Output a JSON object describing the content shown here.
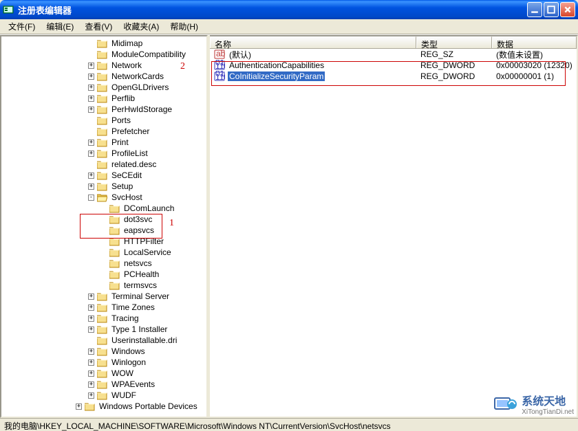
{
  "window": {
    "title": "注册表编辑器"
  },
  "menu": {
    "file": "文件(F)",
    "edit": "编辑(E)",
    "view": "查看(V)",
    "favorites": "收藏夹(A)",
    "help": "帮助(H)"
  },
  "columns": {
    "name": "名称",
    "type": "类型",
    "data": "数据"
  },
  "tree": [
    {
      "depth": 7,
      "exp": "",
      "label": "Midimap"
    },
    {
      "depth": 7,
      "exp": "",
      "label": "ModuleCompatibility"
    },
    {
      "depth": 7,
      "exp": "+",
      "label": "Network"
    },
    {
      "depth": 7,
      "exp": "+",
      "label": "NetworkCards"
    },
    {
      "depth": 7,
      "exp": "+",
      "label": "OpenGLDrivers"
    },
    {
      "depth": 7,
      "exp": "+",
      "label": "Perflib"
    },
    {
      "depth": 7,
      "exp": "+",
      "label": "PerHwIdStorage"
    },
    {
      "depth": 7,
      "exp": "",
      "label": "Ports"
    },
    {
      "depth": 7,
      "exp": "",
      "label": "Prefetcher"
    },
    {
      "depth": 7,
      "exp": "+",
      "label": "Print"
    },
    {
      "depth": 7,
      "exp": "+",
      "label": "ProfileList"
    },
    {
      "depth": 7,
      "exp": "",
      "label": "related.desc"
    },
    {
      "depth": 7,
      "exp": "+",
      "label": "SeCEdit"
    },
    {
      "depth": 7,
      "exp": "+",
      "label": "Setup"
    },
    {
      "depth": 7,
      "exp": "-",
      "label": "SvcHost"
    },
    {
      "depth": 8,
      "exp": "",
      "label": "DComLaunch"
    },
    {
      "depth": 8,
      "exp": "",
      "label": "dot3svc"
    },
    {
      "depth": 8,
      "exp": "",
      "label": "eapsvcs"
    },
    {
      "depth": 8,
      "exp": "",
      "label": "HTTPFilter"
    },
    {
      "depth": 8,
      "exp": "",
      "label": "LocalService"
    },
    {
      "depth": 8,
      "exp": "",
      "label": "netsvcs"
    },
    {
      "depth": 8,
      "exp": "",
      "label": "PCHealth"
    },
    {
      "depth": 8,
      "exp": "",
      "label": "termsvcs"
    },
    {
      "depth": 7,
      "exp": "+",
      "label": "Terminal Server"
    },
    {
      "depth": 7,
      "exp": "+",
      "label": "Time Zones"
    },
    {
      "depth": 7,
      "exp": "+",
      "label": "Tracing"
    },
    {
      "depth": 7,
      "exp": "+",
      "label": "Type 1 Installer"
    },
    {
      "depth": 7,
      "exp": "",
      "label": "Userinstallable.dri"
    },
    {
      "depth": 7,
      "exp": "+",
      "label": "Windows"
    },
    {
      "depth": 7,
      "exp": "+",
      "label": "Winlogon"
    },
    {
      "depth": 7,
      "exp": "+",
      "label": "WOW"
    },
    {
      "depth": 7,
      "exp": "+",
      "label": "WPAEvents"
    },
    {
      "depth": 7,
      "exp": "+",
      "label": "WUDF"
    },
    {
      "depth": 6,
      "exp": "+",
      "label": "Windows Portable Devices"
    }
  ],
  "values": [
    {
      "icon": "sz",
      "name": "(默认)",
      "type": "REG_SZ",
      "data": "(数值未设置)",
      "selected": false
    },
    {
      "icon": "bin",
      "name": "AuthenticationCapabilities",
      "type": "REG_DWORD",
      "data": "0x00003020 (12320)",
      "selected": false
    },
    {
      "icon": "bin",
      "name": "CoInitializeSecurityParam",
      "type": "REG_DWORD",
      "data": "0x00000001 (1)",
      "selected": true
    }
  ],
  "statusbar": "我的电脑\\HKEY_LOCAL_MACHINE\\SOFTWARE\\Microsoft\\Windows NT\\CurrentVersion\\SvcHost\\netsvcs",
  "annotations": {
    "num1": "1",
    "num2": "2"
  },
  "watermark": {
    "text": "系统天地",
    "sub": "XiTongTianDi.net"
  }
}
